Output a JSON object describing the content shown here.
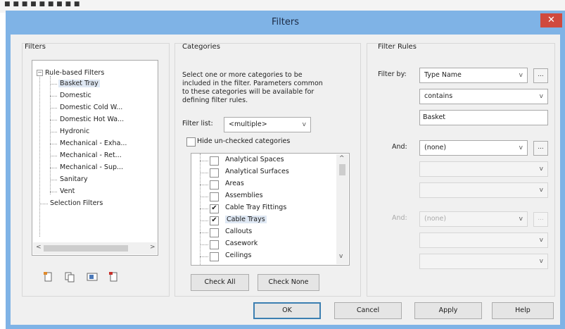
{
  "window": {
    "title": "Filters",
    "close_glyph": "✕",
    "background_hint": "■ ■ ■ ■ ■ ■ ■ ■ ■"
  },
  "filters_panel": {
    "label": "Filters",
    "tree": [
      {
        "label": "Rule-based Filters",
        "expanded": true
      },
      {
        "label": "Basket Tray",
        "selected": true
      },
      {
        "label": "Domestic"
      },
      {
        "label": "Domestic Cold W..."
      },
      {
        "label": "Domestic Hot Wa..."
      },
      {
        "label": "Hydronic"
      },
      {
        "label": "Mechanical - Exha..."
      },
      {
        "label": "Mechanical - Ret..."
      },
      {
        "label": "Mechanical - Sup..."
      },
      {
        "label": "Sanitary"
      },
      {
        "label": "Vent"
      },
      {
        "label": "Selection Filters"
      }
    ],
    "expander_glyph": "−",
    "scroll_left": "<",
    "scroll_right": ">",
    "toolbar_icons": [
      "new-filter-icon",
      "duplicate-filter-icon",
      "rename-filter-icon",
      "delete-filter-icon"
    ]
  },
  "categories_panel": {
    "label": "Categories",
    "instructions": "Select one or more categories to be included in the filter. Parameters common to these categories will be available for defining filter rules.",
    "filter_list_label": "Filter list:",
    "filter_list_value": "<multiple>",
    "hide_unchecked_label": "Hide un-checked categories",
    "hide_unchecked_checked": false,
    "items": [
      {
        "label": "Analytical Spaces",
        "checked": false
      },
      {
        "label": "Analytical Surfaces",
        "checked": false
      },
      {
        "label": "Areas",
        "checked": false
      },
      {
        "label": "Assemblies",
        "checked": false
      },
      {
        "label": "Cable Tray Fittings",
        "checked": true
      },
      {
        "label": "Cable Trays",
        "checked": true,
        "selected": true
      },
      {
        "label": "Callouts",
        "checked": false
      },
      {
        "label": "Casework",
        "checked": false
      },
      {
        "label": "Ceilings",
        "checked": false
      }
    ],
    "check_mark": "✔",
    "scroll_up": "^",
    "scroll_down": "v",
    "check_all_label": "Check All",
    "check_none_label": "Check None"
  },
  "rules_panel": {
    "label": "Filter Rules",
    "filter_by_label": "Filter by:",
    "filter_by_value": "Type Name",
    "operator_value": "contains",
    "value_text": "Basket",
    "and1_label": "And:",
    "and1_value": "(none)",
    "and2_label": "And:",
    "and2_value": "(none)",
    "ellipsis": "...",
    "chevron": "v"
  },
  "footer": {
    "ok_label": "OK",
    "cancel_label": "Cancel",
    "apply_label": "Apply",
    "help_label": "Help"
  },
  "colors": {
    "title_bar": "#7fb3e6",
    "close_button": "#d04a3e",
    "client_bg": "#f0f0f0",
    "selection": "#dfe8f4"
  }
}
